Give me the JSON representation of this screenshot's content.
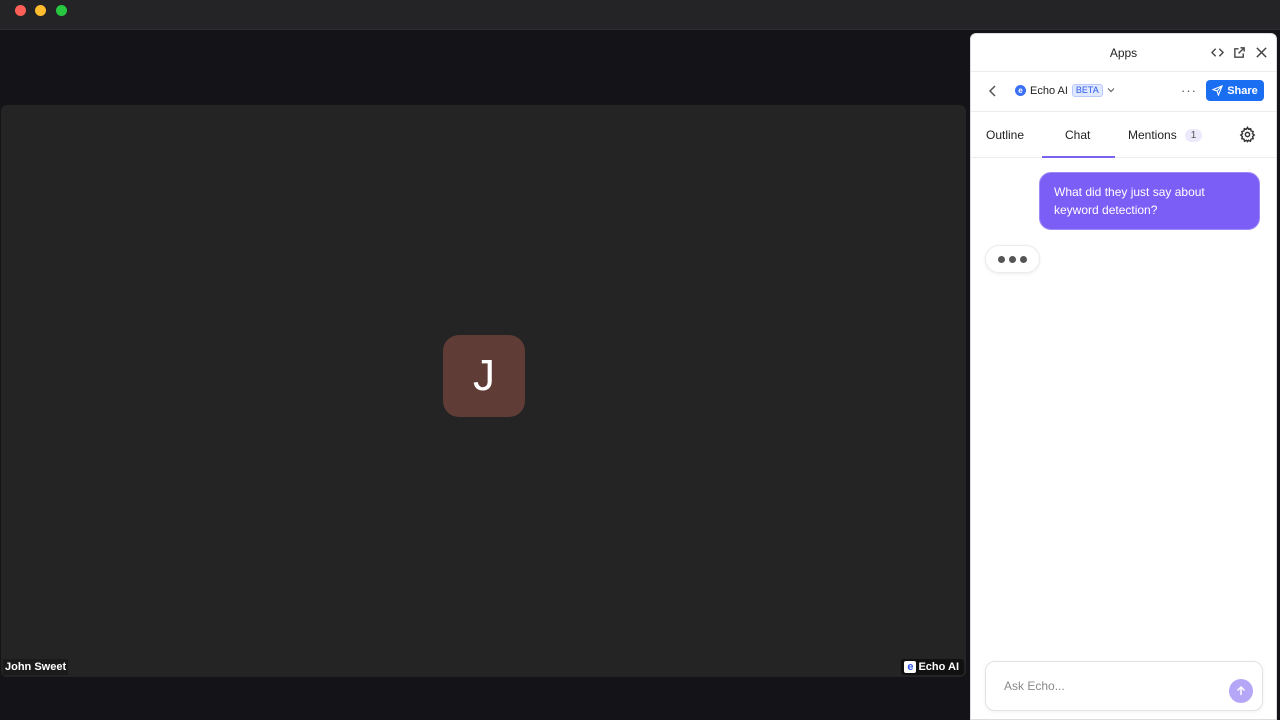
{
  "window": {
    "traffic_lights": [
      "close",
      "minimize",
      "maximize"
    ]
  },
  "meeting": {
    "participant_initial": "J",
    "participant_name": "John Sweet",
    "echo_badge": "Echo AI",
    "echo_badge_logo": "e"
  },
  "panel": {
    "title": "Apps",
    "header_icons": [
      "code-icon",
      "popout-icon",
      "close-icon"
    ],
    "app": {
      "logo": "e",
      "name": "Echo AI",
      "badge": "BETA",
      "more_label": "···",
      "share_label": "Share"
    },
    "tabs": [
      {
        "label": "Outline"
      },
      {
        "label": "Chat",
        "active": true
      },
      {
        "label": "Mentions",
        "count": "1"
      }
    ],
    "chat": {
      "messages": [
        {
          "role": "user",
          "text": "What did they just say about keyword detection?"
        }
      ],
      "typing": true
    },
    "composer": {
      "placeholder": "Ask Echo..."
    }
  },
  "colors": {
    "accent": "#7b5ef6",
    "share": "#1a6ef2",
    "avatar": "#5f3c35"
  }
}
